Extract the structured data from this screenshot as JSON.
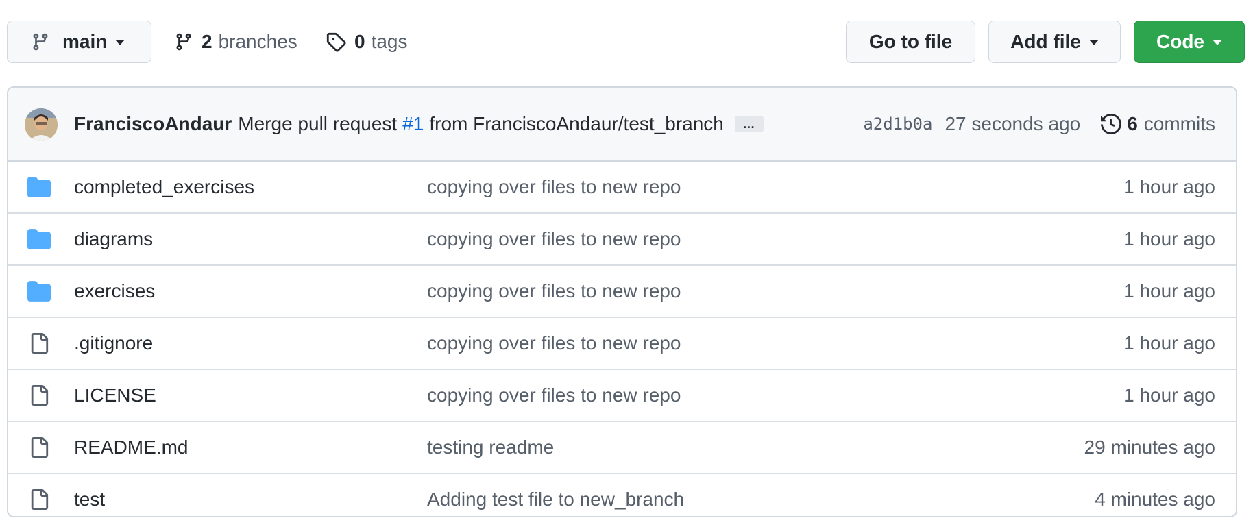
{
  "toolbar": {
    "branch_label": "main",
    "branches_count": "2",
    "branches_label": "branches",
    "tags_count": "0",
    "tags_label": "tags",
    "goto_file_label": "Go to file",
    "add_file_label": "Add file",
    "code_label": "Code"
  },
  "colors": {
    "code_button_bg": "#2da44e",
    "folder_icon": "#54aeff",
    "link": "#0969da"
  },
  "commit": {
    "author": "FranciscoAndaur",
    "message_prefix": "Merge pull request",
    "pr_number": "#1",
    "message_suffix": "from FranciscoAndaur/test_branch",
    "ellipsis": "…",
    "sha": "a2d1b0a",
    "time": "27 seconds ago",
    "commits_count": "6",
    "commits_label": "commits"
  },
  "files": [
    {
      "type": "folder",
      "icon": "folder-icon",
      "name": "completed_exercises",
      "message": "copying over files to new repo",
      "age": "1 hour ago"
    },
    {
      "type": "folder",
      "icon": "folder-icon",
      "name": "diagrams",
      "message": "copying over files to new repo",
      "age": "1 hour ago"
    },
    {
      "type": "folder",
      "icon": "folder-icon",
      "name": "exercises",
      "message": "copying over files to new repo",
      "age": "1 hour ago"
    },
    {
      "type": "file",
      "icon": "file-icon",
      "name": ".gitignore",
      "message": "copying over files to new repo",
      "age": "1 hour ago"
    },
    {
      "type": "file",
      "icon": "file-icon",
      "name": "LICENSE",
      "message": "copying over files to new repo",
      "age": "1 hour ago"
    },
    {
      "type": "file",
      "icon": "file-icon",
      "name": "README.md",
      "message": "testing readme",
      "age": "29 minutes ago"
    },
    {
      "type": "file",
      "icon": "file-icon",
      "name": "test",
      "message": "Adding test file to new_branch",
      "age": "4 minutes ago"
    }
  ]
}
